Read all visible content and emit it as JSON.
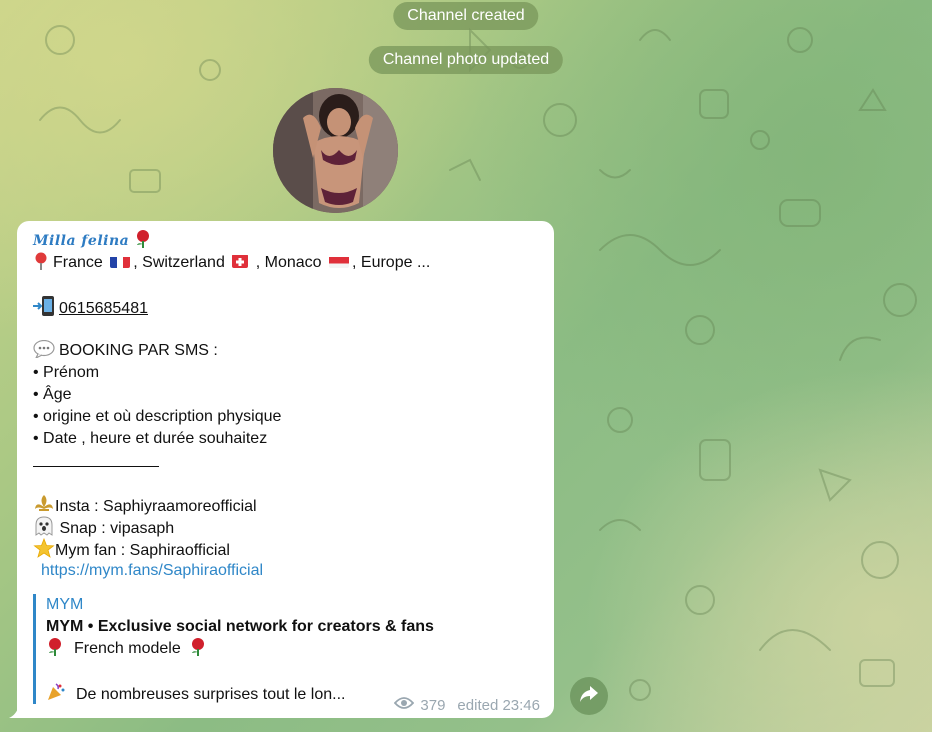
{
  "service_messages": {
    "created": "Channel created",
    "photo_updated": "Channel photo updated"
  },
  "post": {
    "author": "Milla felina",
    "location_text_1": "France",
    "location_text_2": ", Switzerland",
    "location_text_3": ", Monaco",
    "location_text_4": ", Europe ...",
    "phone": "0615685481",
    "booking_title": "BOOKING PAR SMS :",
    "booking_items": [
      "• Prénom",
      "• Âge",
      "• origine et où description physique",
      "• Date , heure et durée souhaitez"
    ],
    "insta": "Insta : Saphiyraamoreofficial",
    "snap": " Snap : vipasaph",
    "mym": "Mym fan : Saphiraofficial",
    "mym_link": "https://mym.fans/Saphiraofficial"
  },
  "preview": {
    "site": "MYM",
    "title": "MYM • Exclusive social network for creators & fans",
    "line1": "French modele",
    "line2": "De nombreuses surprises tout le lon..."
  },
  "meta": {
    "views": "379",
    "edited": "edited 23:46"
  },
  "icons": {
    "rose": "rose-emoji",
    "pin": "round-pushpin-emoji",
    "phone": "mobile-phone-arrow-emoji",
    "speech": "speech-bubble-emoji",
    "fleur": "fleur-de-lis-emoji",
    "ghost": "ghost-emoji",
    "star": "glowing-star-emoji",
    "party": "party-popper-emoji",
    "eye": "eye-icon",
    "share": "share-arrow-icon"
  },
  "colors": {
    "link": "#2f87c8",
    "author": "#2d7bc2",
    "meta": "#9aa7b0"
  }
}
